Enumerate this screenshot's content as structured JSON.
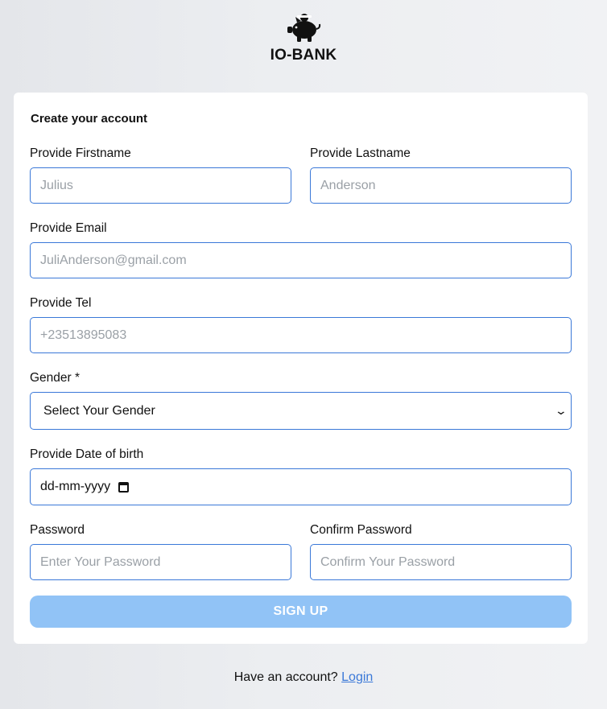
{
  "brand": {
    "name": "IO-BANK",
    "icon": "piggy-bank-icon"
  },
  "form": {
    "title": "Create your account",
    "firstname": {
      "label": "Provide Firstname",
      "placeholder": "Julius"
    },
    "lastname": {
      "label": "Provide Lastname",
      "placeholder": "Anderson"
    },
    "email": {
      "label": "Provide Email",
      "placeholder": "JuliAnderson@gmail.com"
    },
    "tel": {
      "label": "Provide Tel",
      "placeholder": "+23513895083"
    },
    "gender": {
      "label": "Gender *",
      "selected": "Select Your Gender"
    },
    "dob": {
      "label": "Provide Date of birth",
      "value": "dd-mm-yyyy",
      "icon": "calendar-icon"
    },
    "password": {
      "label": "Password",
      "placeholder": "Enter Your Password"
    },
    "confirm_password": {
      "label": "Confirm Password",
      "placeholder": "Confirm Your Password"
    },
    "submit_label": "SIGN UP"
  },
  "footer": {
    "prompt": "Have an account?",
    "login_link": "Login"
  },
  "colors": {
    "accent": "#3a78d8",
    "button_disabled": "#91c3f6",
    "background": "#e4e6ea",
    "card": "#ffffff"
  }
}
